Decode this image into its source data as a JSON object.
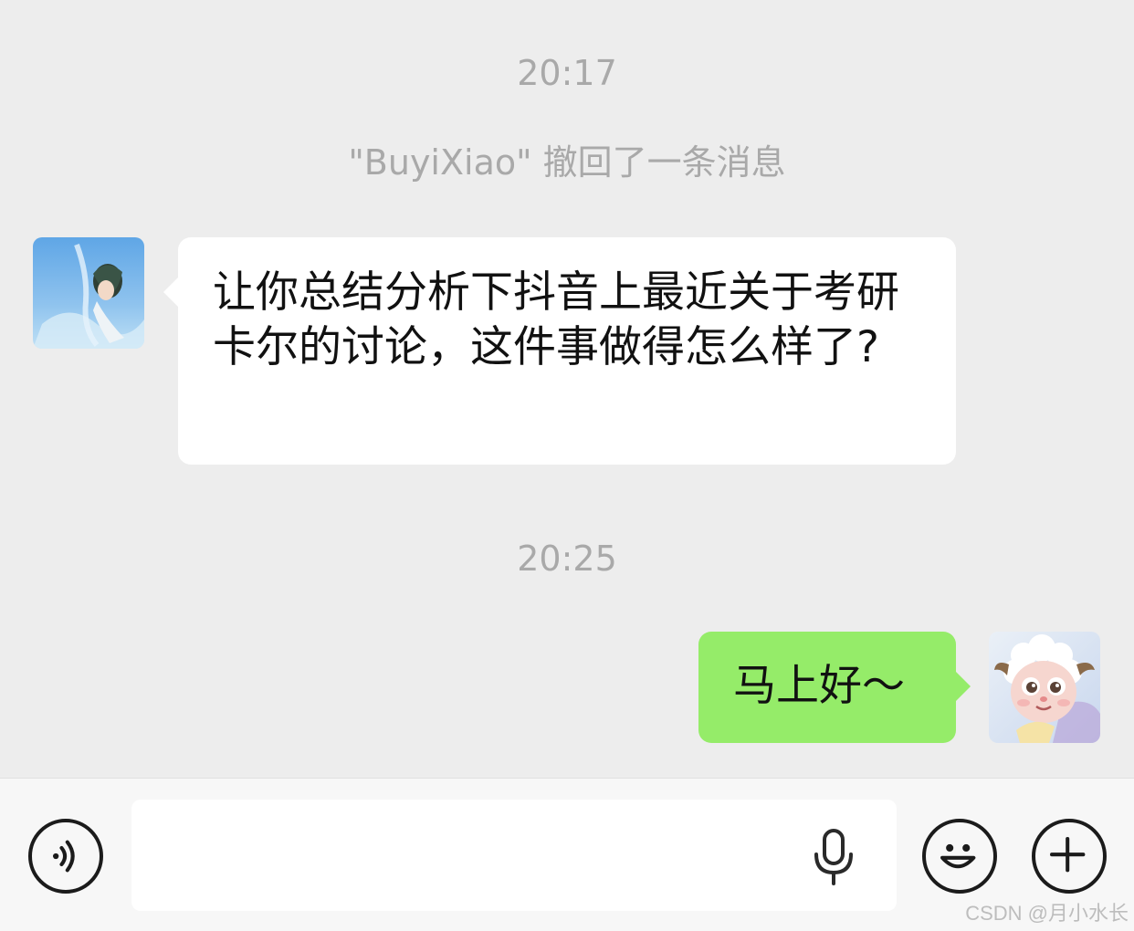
{
  "messages": {
    "time_1": "20:17",
    "recall_notice": "\"BuyiXiao\" 撤回了一条消息",
    "incoming_text": "让你总结分析下抖音上最近关于考研卡尔的讨论，这件事做得怎么样了?",
    "time_2": "20:25",
    "outgoing_text": "马上好～"
  },
  "input_bar": {
    "voice_icon": "voice-toggle-icon",
    "mic_icon": "microphone-icon",
    "emoji_icon": "emoji-icon",
    "plus_icon": "plus-icon",
    "input_value": ""
  },
  "watermark": "CSDN @月小水长",
  "colors": {
    "background": "#ededed",
    "incoming_bubble": "#ffffff",
    "outgoing_bubble": "#95ec69",
    "meta_text": "#a9a9a9"
  }
}
